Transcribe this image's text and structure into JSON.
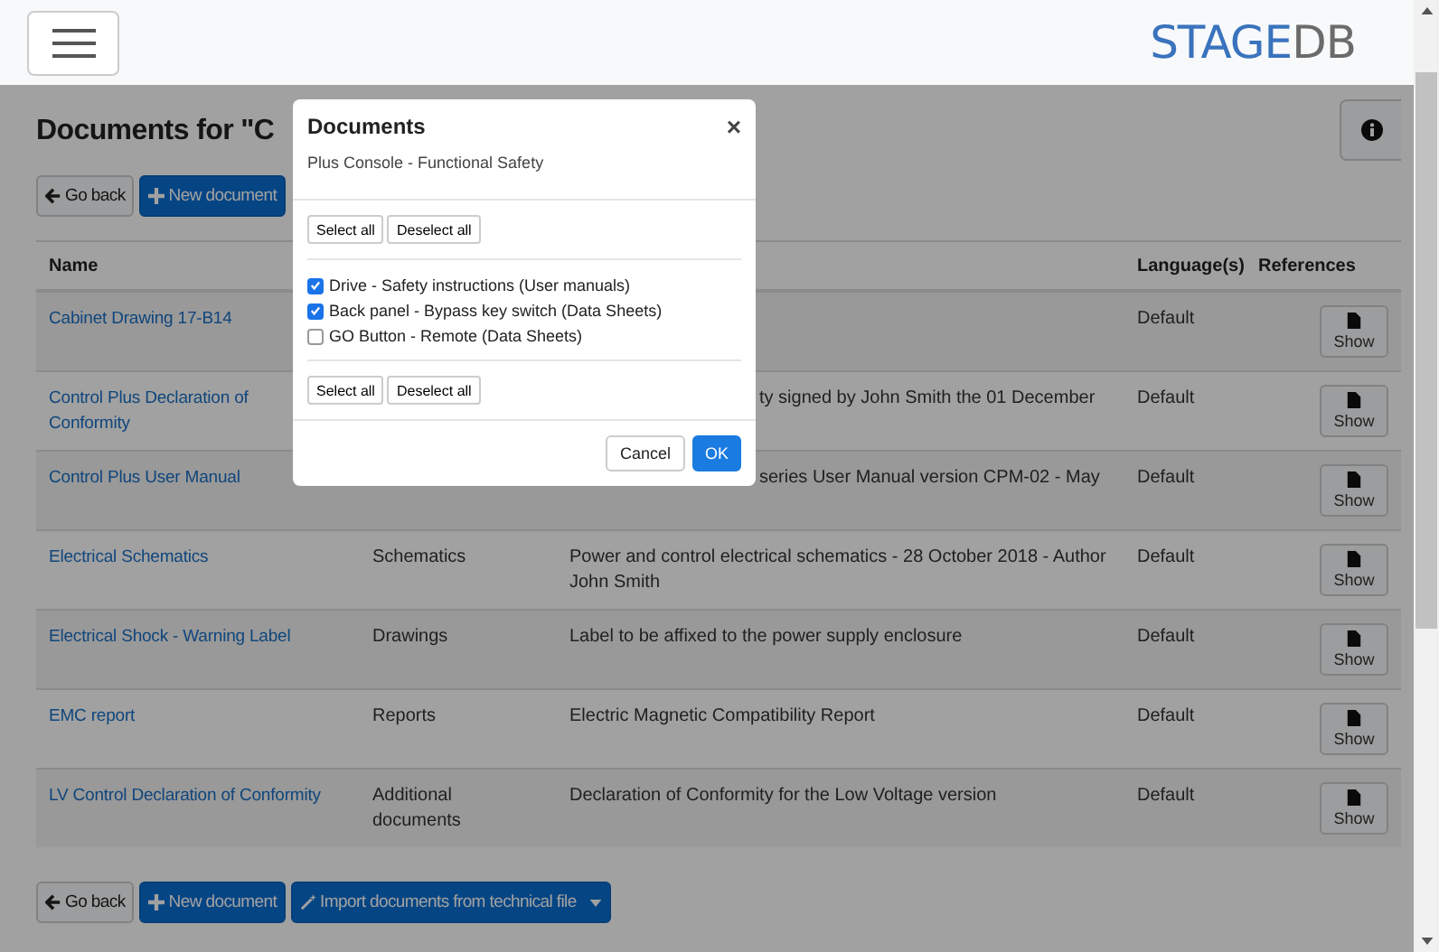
{
  "header": {
    "logo": {
      "part_1": "STAGE",
      "part_2": "DB"
    }
  },
  "page": {
    "title": "Documents for \"C",
    "top_buttons": [
      {
        "kind": "back",
        "label": "Go back"
      },
      {
        "kind": "new",
        "label": "New document"
      }
    ],
    "table": {
      "columns": [
        "Name",
        "",
        "",
        "Language(s)",
        "References"
      ],
      "rows": [
        {
          "name": "Cabinet Drawing 17-B14",
          "language": "Default",
          "action": "Show"
        },
        {
          "name": "Control Plus Declaration of Conformity",
          "description": "ty signed by John Smith the 01 December",
          "language": "Default",
          "action": "Show"
        },
        {
          "name": "Control Plus User Manual",
          "description": "series User Manual version CPM-02 - May",
          "language": "Default",
          "action": "Show"
        },
        {
          "name": "Electrical Schematics",
          "type": "Schematics",
          "description": "Power and control electrical schematics - 28 October 2018 - Author John Smith",
          "language": "Default",
          "action": "Show"
        },
        {
          "name": "Electrical Shock - Warning Label",
          "type": "Drawings",
          "description": "Label to be affixed to the power supply enclosure",
          "language": "Default",
          "action": "Show"
        },
        {
          "name": "EMC report",
          "type": "Reports",
          "description": "Electric Magnetic Compatibility Report",
          "language": "Default",
          "action": "Show"
        },
        {
          "name": "LV Control Declaration of Conformity",
          "type": "Additional documents",
          "description": "Declaration of Conformity for the Low Voltage version",
          "language": "Default",
          "action": "Show"
        }
      ]
    },
    "bottom_buttons": [
      {
        "kind": "back",
        "label": "Go back"
      },
      {
        "kind": "new",
        "label": "New document"
      },
      {
        "kind": "import",
        "label": "Import documents from technical file"
      }
    ]
  },
  "modal": {
    "title": "Documents",
    "close": "×",
    "subtitle": "Plus Console - Functional Safety",
    "select_buttons_top": [
      "Select all",
      "Deselect all"
    ],
    "items": [
      {
        "label": "Drive - Safety instructions (User manuals)",
        "checked": true
      },
      {
        "label": "Back panel - Bypass key switch (Data Sheets)",
        "checked": true
      },
      {
        "label": "GO Button - Remote (Data Sheets)",
        "checked": false
      }
    ],
    "select_buttons_bottom": [
      "Select all",
      "Deselect all"
    ],
    "footer_buttons": [
      {
        "kind": "secondary",
        "label": "Cancel"
      },
      {
        "kind": "primary",
        "label": "OK"
      }
    ]
  }
}
